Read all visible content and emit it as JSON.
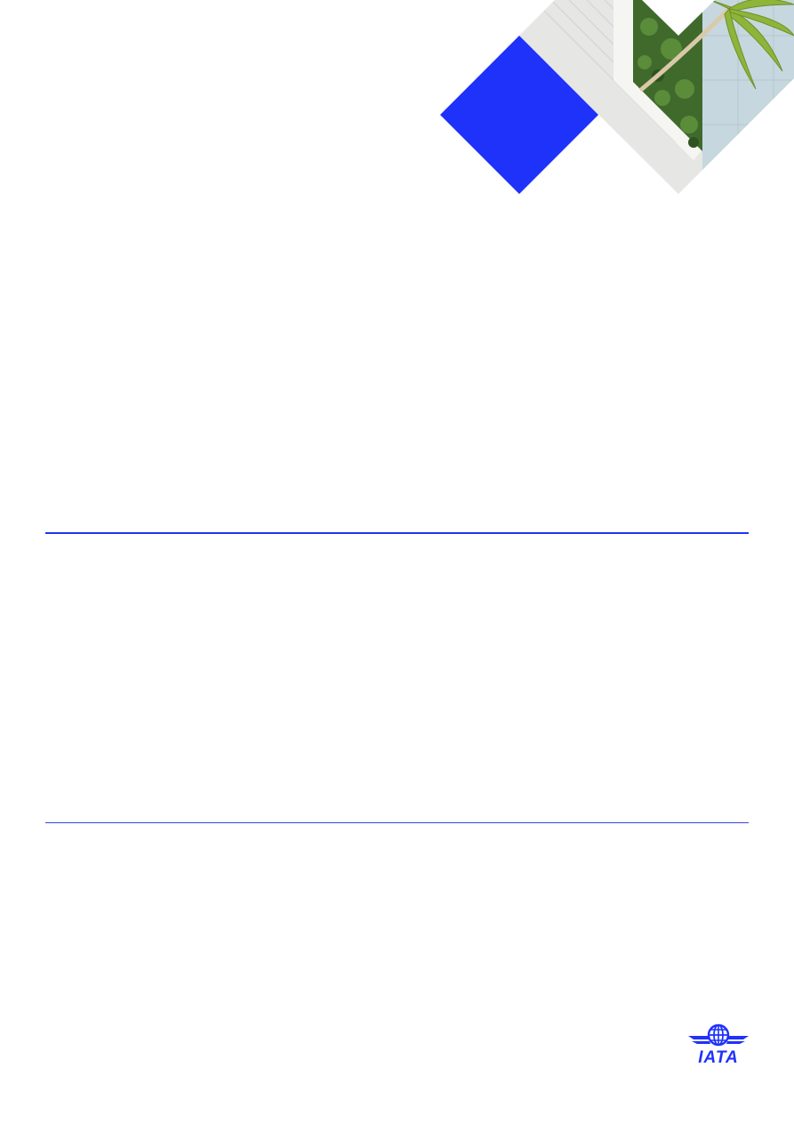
{
  "cover": {
    "accent_color": "#1e32fa",
    "rule_color": "#1f35f0"
  },
  "hero": {
    "photo_description_icon": "palm-tree-courtyard-icon",
    "accent_shape_icon": "blue-diamond-icon"
  },
  "logo": {
    "text": "IATA",
    "icon": "iata-globe-wings-icon"
  }
}
